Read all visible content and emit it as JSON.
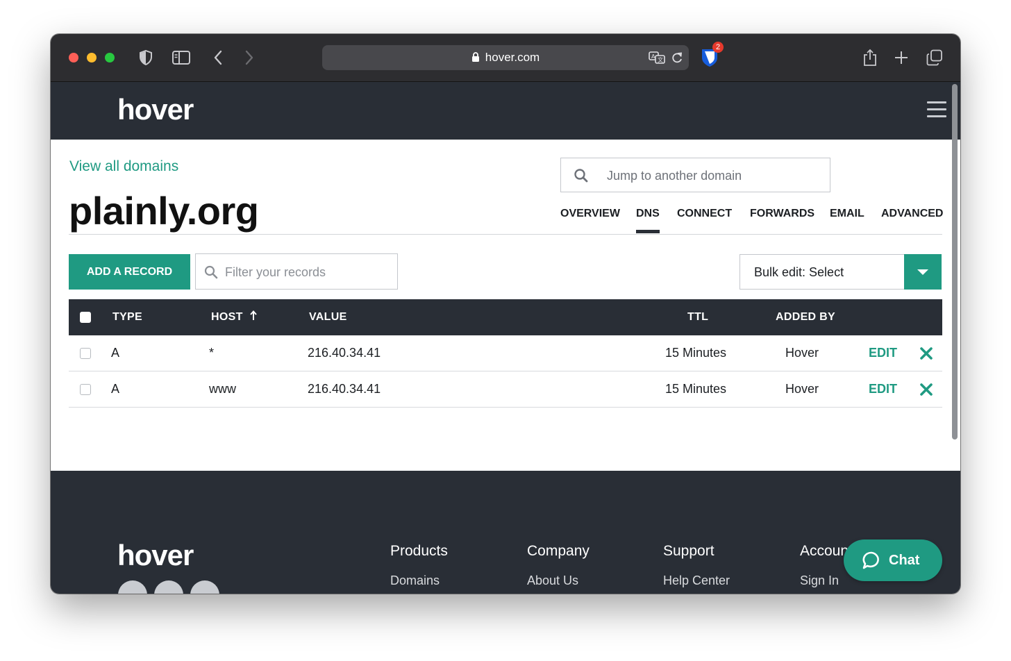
{
  "browser": {
    "url": "hover.com",
    "extension_badge": "2"
  },
  "site": {
    "logo": "hover"
  },
  "domain_page": {
    "back_link": "View all domains",
    "domain": "plainly.org",
    "jump_placeholder": "Jump to another domain",
    "tabs": [
      "OVERVIEW",
      "DNS",
      "CONNECT",
      "FORWARDS",
      "EMAIL",
      "ADVANCED"
    ],
    "active_tab": "DNS"
  },
  "dns": {
    "add_button": "ADD A RECORD",
    "filter_placeholder": "Filter your records",
    "bulk_edit": "Bulk edit: Select",
    "columns": {
      "type": "TYPE",
      "host": "HOST",
      "value": "VALUE",
      "ttl": "TTL",
      "added_by": "ADDED BY"
    },
    "records": [
      {
        "type": "A",
        "host": "*",
        "value": "216.40.34.41",
        "ttl": "15 Minutes",
        "added_by": "Hover",
        "edit": "EDIT"
      },
      {
        "type": "A",
        "host": "www",
        "value": "216.40.34.41",
        "ttl": "15 Minutes",
        "added_by": "Hover",
        "edit": "EDIT"
      }
    ]
  },
  "footer": {
    "logo": "hover",
    "columns": [
      {
        "title": "Products",
        "first_link": "Domains"
      },
      {
        "title": "Company",
        "first_link": "About Us"
      },
      {
        "title": "Support",
        "first_link": "Help Center"
      },
      {
        "title": "Account",
        "first_link": "Sign In"
      }
    ],
    "social": [
      "twitter-icon",
      "facebook-icon",
      "linkedin-icon"
    ]
  },
  "chat": {
    "label": "Chat"
  },
  "colors": {
    "accent": "#1f9a82",
    "dark": "#292e36",
    "chrome": "#2d2d30"
  }
}
